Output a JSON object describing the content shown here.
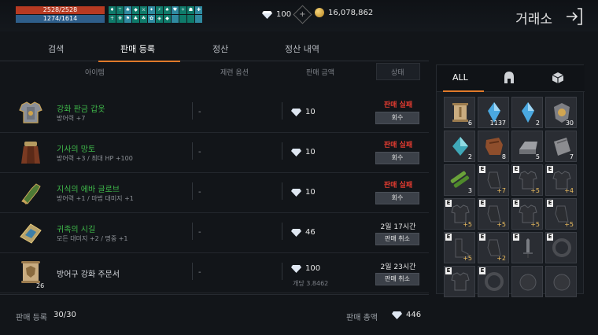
{
  "hud": {
    "hp": "2528/2528",
    "mp": "1274/1614",
    "buffs": [
      "♦",
      "⚚",
      "♣",
      "◆",
      "⚔",
      "✦",
      "⚡",
      "♠",
      "♥",
      "✧",
      "☗",
      "✚",
      "☥",
      "❋",
      "⚑",
      "♣",
      "☘",
      "✿",
      "◈",
      "◆",
      "",
      "",
      "",
      ""
    ]
  },
  "currency": {
    "diamonds": "100",
    "plus_label": "+",
    "gold": "16,078,862"
  },
  "page": {
    "title": "거래소"
  },
  "tabs": {
    "search": "검색",
    "register": "판매 등록",
    "settle": "정산",
    "history": "정산 내역"
  },
  "columns": {
    "item": "아이템",
    "option": "제련 옵션",
    "price": "판매 금액",
    "state": "상태"
  },
  "listings": [
    {
      "name": "강화 판금 갑옷",
      "stat": "방어력 +7",
      "option": "-",
      "price": "10",
      "status": "판매 실패",
      "button": "회수",
      "kind": "fail"
    },
    {
      "name": "기사의 망토",
      "stat": "방어력 +3 / 최대 HP +100",
      "option": "-",
      "price": "10",
      "status": "판매 실패",
      "button": "회수",
      "kind": "fail"
    },
    {
      "name": "지식의 에바 글로브",
      "stat": "방어력 +1 / 마법 대미지 +1",
      "option": "-",
      "price": "10",
      "status": "판매 실패",
      "button": "회수",
      "kind": "fail"
    },
    {
      "name": "귀족의 시길",
      "stat": "모든 대미지 +2 / 명중 +1",
      "option": "-",
      "price": "46",
      "status": "2일 17시간",
      "button": "판매 취소",
      "kind": "time"
    },
    {
      "name": "방어구 강화 주문서",
      "stat": "",
      "option": "-",
      "price": "100",
      "each": "개당 3.8462",
      "qty": "26",
      "status": "2일 23시간",
      "button": "판매 취소",
      "kind": "time"
    }
  ],
  "footer": {
    "count_label": "판매 등록",
    "count": "30/30",
    "total_label": "판매 총액",
    "total": "446"
  },
  "inventory": {
    "tab_all": "ALL",
    "slots": [
      {
        "type": "scroll",
        "qty": "6"
      },
      {
        "type": "crystal-blue",
        "qty": "1137"
      },
      {
        "type": "crystal-blue",
        "qty": "2"
      },
      {
        "type": "shield-gem",
        "qty": "30"
      },
      {
        "type": "crystal-teal",
        "qty": "2"
      },
      {
        "type": "hide",
        "qty": "8"
      },
      {
        "type": "ingot",
        "qty": "5"
      },
      {
        "type": "cloth",
        "qty": "7"
      },
      {
        "type": "bamboo",
        "qty": "3"
      },
      {
        "type": "gauntlet",
        "enh": "+7",
        "eq": "E"
      },
      {
        "type": "armor",
        "enh": "+5",
        "eq": "E"
      },
      {
        "type": "armor",
        "enh": "+4",
        "eq": "E"
      },
      {
        "type": "armor",
        "enh": "+5",
        "eq": "E"
      },
      {
        "type": "gauntlet",
        "enh": "+5",
        "eq": "E"
      },
      {
        "type": "armor",
        "enh": "+5",
        "eq": "E"
      },
      {
        "type": "gauntlet",
        "enh": "+5",
        "eq": "E"
      },
      {
        "type": "boots",
        "enh": "+5",
        "eq": "E"
      },
      {
        "type": "gauntlet",
        "enh": "+2",
        "eq": "E"
      },
      {
        "type": "sword",
        "enh": "",
        "eq": "E"
      },
      {
        "type": "ring",
        "enh": "",
        "eq": "E"
      },
      {
        "type": "armor",
        "enh": "",
        "eq": "E"
      },
      {
        "type": "ring",
        "enh": "",
        "eq": "E"
      },
      {
        "type": "orb",
        "enh": "",
        "eq": ""
      },
      {
        "type": "orb",
        "enh": "",
        "eq": ""
      }
    ]
  }
}
